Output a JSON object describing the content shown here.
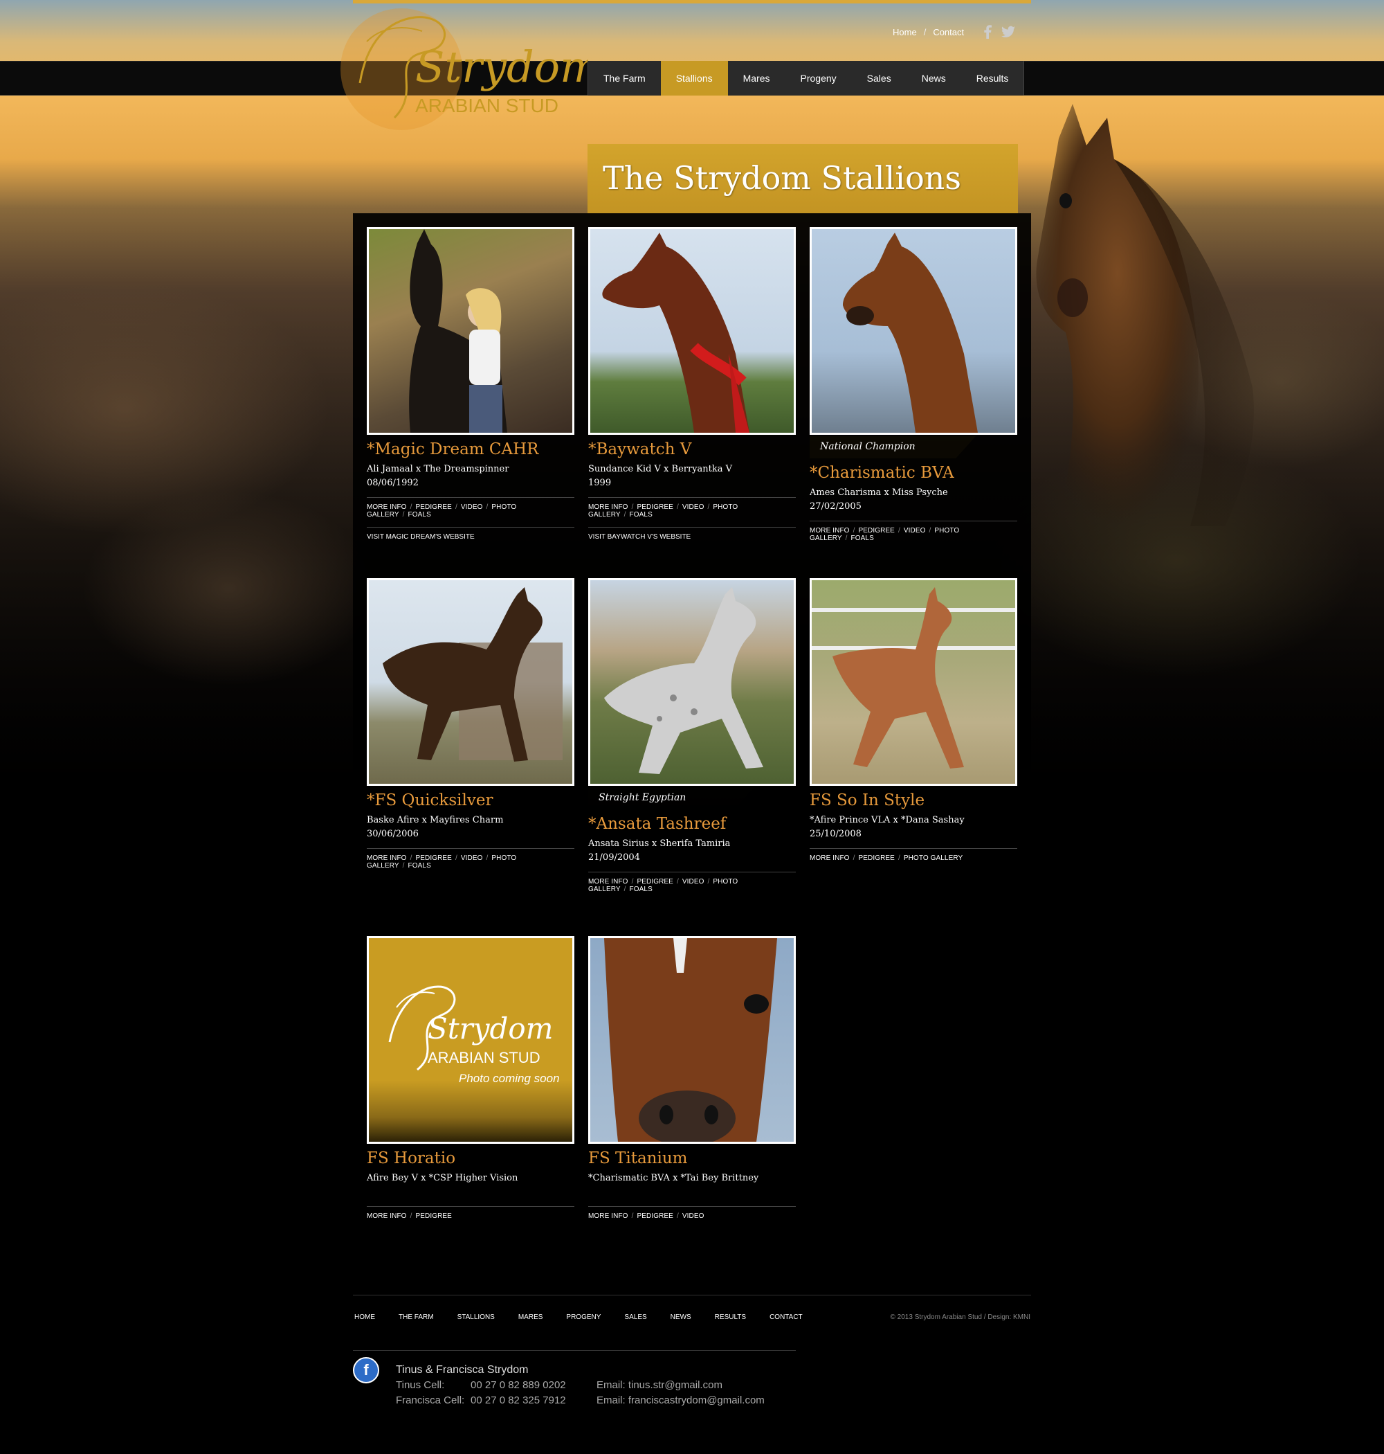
{
  "header": {
    "top_links": [
      "Home",
      "Contact"
    ],
    "social_icons": [
      "facebook-icon",
      "twitter-icon"
    ],
    "logo_text": "Strydom",
    "logo_subtext": "ARABIAN STUD"
  },
  "nav": {
    "items": [
      "The Farm",
      "Stallions",
      "Mares",
      "Progeny",
      "Sales",
      "News",
      "Results"
    ],
    "active": "Stallions"
  },
  "page": {
    "title": "The Strydom Stallions"
  },
  "stallions": [
    {
      "name": "*Magic Dream CAHR",
      "pedigree": "Ali Jamaal x The Dreamspinner",
      "date": "08/06/1992",
      "links": [
        "MORE INFO",
        "PEDIGREE",
        "VIDEO",
        "PHOTO GALLERY",
        "FOALS"
      ],
      "visit": "VISIT MAGIC DREAM'S WEBSITE",
      "ribbon": ""
    },
    {
      "name": "*Baywatch V",
      "pedigree": "Sundance Kid V x Berryantka V",
      "date": "1999",
      "links": [
        "MORE INFO",
        "PEDIGREE",
        "VIDEO",
        "PHOTO GALLERY",
        "FOALS"
      ],
      "visit": "VISIT BAYWATCH V'S WEBSITE",
      "ribbon": ""
    },
    {
      "name": "*Charismatic BVA",
      "pedigree": "Ames Charisma x Miss Psyche",
      "date": "27/02/2005",
      "links": [
        "MORE INFO",
        "PEDIGREE",
        "VIDEO",
        "PHOTO GALLERY",
        "FOALS"
      ],
      "visit": "",
      "ribbon": "National Champion"
    },
    {
      "name": "*FS Quicksilver",
      "pedigree": "Baske Afire x Mayfires Charm",
      "date": "30/06/2006",
      "links": [
        "MORE INFO",
        "PEDIGREE",
        "VIDEO",
        "PHOTO GALLERY",
        "FOALS"
      ],
      "visit": "",
      "ribbon": ""
    },
    {
      "name": "*Ansata Tashreef",
      "pedigree": "Ansata Sirius x Sherifa Tamiria",
      "date": "21/09/2004",
      "links": [
        "MORE INFO",
        "PEDIGREE",
        "VIDEO",
        "PHOTO GALLERY",
        "FOALS"
      ],
      "visit": "",
      "ribbon": "Straight Egyptian"
    },
    {
      "name": "FS So In Style",
      "pedigree": "*Afire Prince VLA x  *Dana Sashay",
      "date": "25/10/2008",
      "links": [
        "MORE INFO",
        "PEDIGREE",
        "PHOTO GALLERY"
      ],
      "visit": "",
      "ribbon": ""
    },
    {
      "name": "FS Horatio",
      "pedigree": "Afire Bey V x  *CSP Higher Vision",
      "date": "",
      "links": [
        "MORE INFO",
        "PEDIGREE"
      ],
      "visit": "",
      "ribbon": "",
      "placeholder_text": "Photo coming soon"
    },
    {
      "name": "FS Titanium",
      "pedigree": "*Charismatic BVA x  *Tai Bey Brittney",
      "date": "",
      "links": [
        "MORE INFO",
        "PEDIGREE",
        "VIDEO"
      ],
      "visit": "",
      "ribbon": ""
    }
  ],
  "footer": {
    "nav": [
      "HOME",
      "THE FARM",
      "STALLIONS",
      "MARES",
      "PROGENY",
      "SALES",
      "NEWS",
      "RESULTS",
      "CONTACT"
    ],
    "copyright": "© 2013 Strydom Arabian Stud   /   Design: KMNI",
    "contact": {
      "names": "Tinus & Francisca Strydom",
      "tinus_label": "Tinus Cell:",
      "tinus_cell": "00 27 0 82 889 0202",
      "tinus_email": "Email: tinus.str@gmail.com",
      "francisca_label": "Francisca Cell:",
      "francisca_cell": "00 27 0 82 325 7912",
      "francisca_email": "Email: franciscastrydom@gmail.com"
    }
  },
  "colors": {
    "accent_gold": "#c79a24",
    "name_orange": "#e79a3c",
    "panel_black": "#000000"
  }
}
